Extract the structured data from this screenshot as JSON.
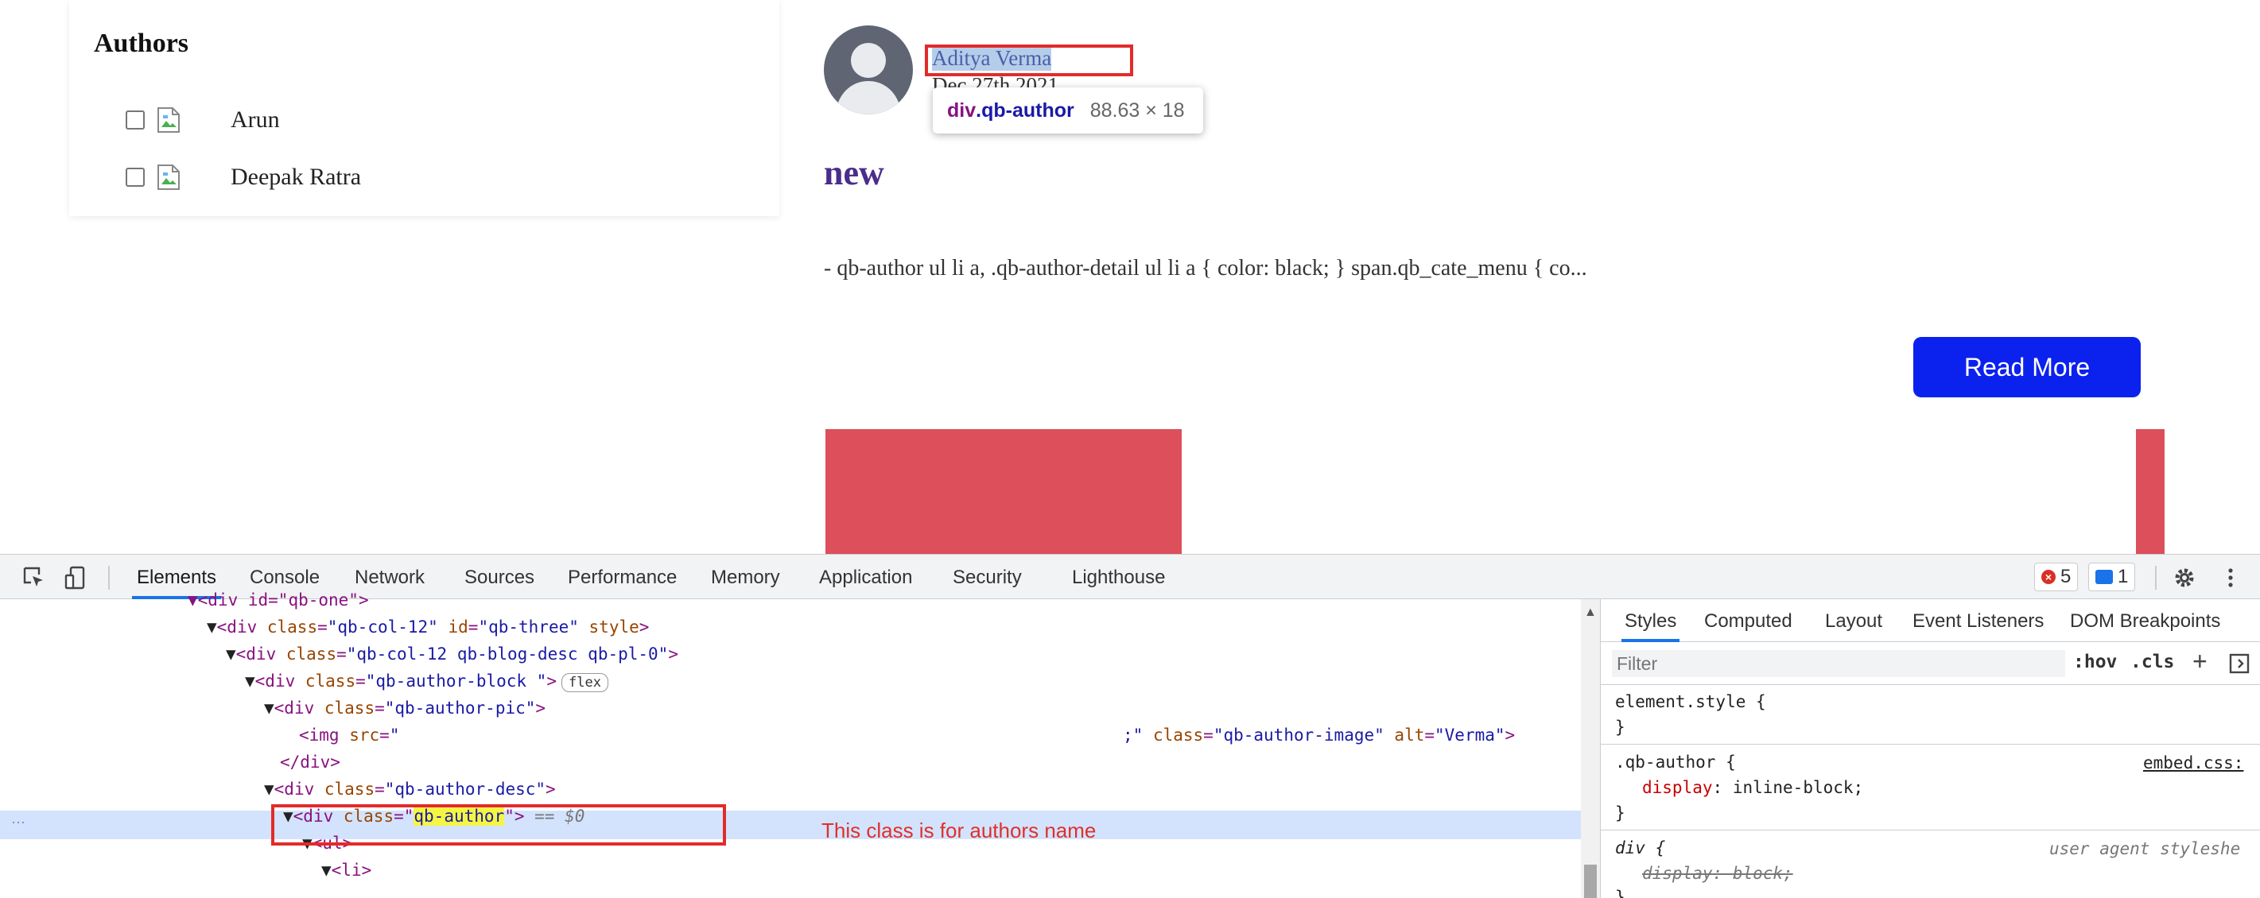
{
  "page": {
    "authors_heading": "Authors",
    "authors": [
      {
        "name": "Arun"
      },
      {
        "name": "Deepak Ratra"
      }
    ],
    "post": {
      "author_name": "Aditya Verma",
      "date": "Dec 27th 2021",
      "title": "new",
      "excerpt": "- qb-author ul li a, .qb-author-detail ul li a { color: black; } span.qb_cate_menu { co...",
      "read_more": "Read More"
    },
    "inspect_tooltip": {
      "tag": "div",
      "class": ".qb-author",
      "dims": "88.63 × 18"
    }
  },
  "devtools": {
    "tabs": [
      "Elements",
      "Console",
      "Network",
      "Sources",
      "Performance",
      "Memory",
      "Application",
      "Security",
      "Lighthouse"
    ],
    "active_tab": "Elements",
    "error_count": "5",
    "message_count": "1",
    "dom": {
      "l0": "<div id=\"qb-one\">",
      "l1_tag": "<div ",
      "l1_attr1": "class",
      "l1_val1": "\"qb-col-12\"",
      "l1_attr2": "id",
      "l1_val2": "\"qb-three\"",
      "l1_attr3": "style",
      "l2_attr": "class",
      "l2_val": "\"qb-col-12 qb-blog-desc qb-pl-0\"",
      "l3_attr": "class",
      "l3_val": "\"qb-author-block \"",
      "l3_badge": "flex",
      "l4_attr": "class",
      "l4_val": "\"qb-author-pic\"",
      "l5_attr1": "src",
      "l5_val1": "\"",
      "l5_val1_end": ";\"",
      "l5_attr2": "class",
      "l5_val2": "\"qb-author-image\"",
      "l5_attr3": "alt",
      "l5_val3": "\"Verma\"",
      "l6": "</div>",
      "l7_attr": "class",
      "l7_val": "\"qb-author-desc\"",
      "l8_attr": "class",
      "l8_val": "qb-author",
      "l8_eq": "== $0",
      "l9": "<ul>",
      "l10": "<li>"
    },
    "annotation": "This class is for authors name",
    "styles": {
      "tabs": [
        "Styles",
        "Computed",
        "Layout",
        "Event Listeners",
        "DOM Breakpoints"
      ],
      "active_tab": "Styles",
      "filter_placeholder": "Filter",
      "hov": ":hov",
      "cls": ".cls",
      "rules": [
        {
          "selector": "element.style {",
          "close": "}"
        },
        {
          "selector": ".qb-author {",
          "source": "embed.css:",
          "prop": "display",
          "value": "inline-block;",
          "close": "}"
        },
        {
          "selector": "div {",
          "source": "user agent styleshe",
          "prop": "display",
          "value": "block;",
          "close": "}"
        }
      ]
    }
  }
}
